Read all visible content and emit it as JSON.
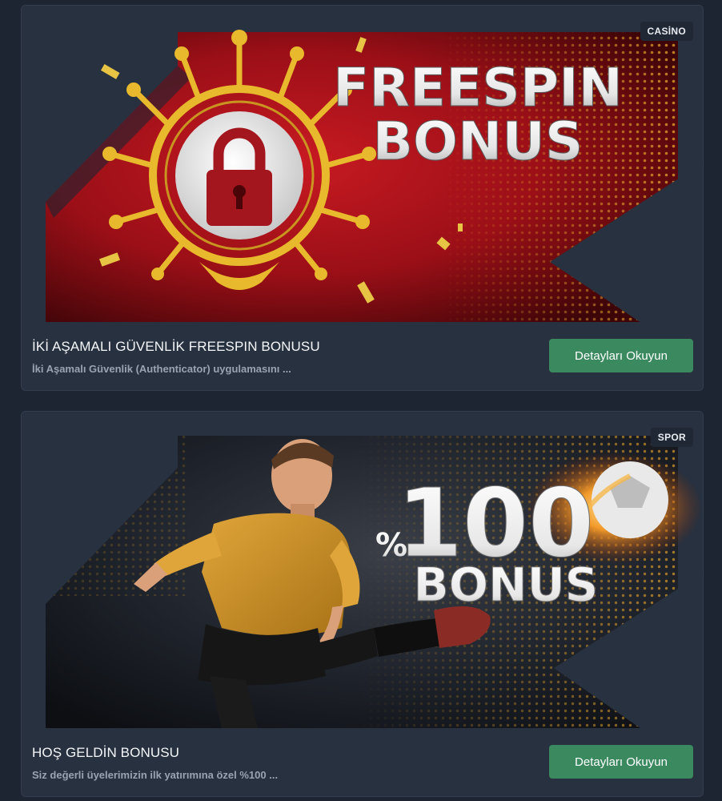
{
  "promotions": [
    {
      "category": "CASİNO",
      "banner_headline_line1": "FREESPIN",
      "banner_headline_line2": "BONUS",
      "title": "İKİ AŞAMALI GÜVENLİK FREESPIN BONUSU",
      "description": "İki Aşamalı Güvenlik (Authenticator) uygulamasını ...",
      "button_label": "Detayları Okuyun",
      "banner_icon": "padlock-icon"
    },
    {
      "category": "SPOR",
      "banner_headline_prefix": "%",
      "banner_headline_line1": "100",
      "banner_headline_line2": "BONUS",
      "title": "HOŞ GELDİN BONUSU",
      "description": "Siz değerli üyelerimizin ilk yatırımına özel %100 ...",
      "button_label": "Detayları Okuyun",
      "banner_icon": "football-player-image"
    }
  ],
  "colors": {
    "page_bg": "#1d2533",
    "card_bg": "#28313f",
    "button_green": "#3b8a5f",
    "casino_red": "#b8141c",
    "gold": "#e8b92c"
  }
}
